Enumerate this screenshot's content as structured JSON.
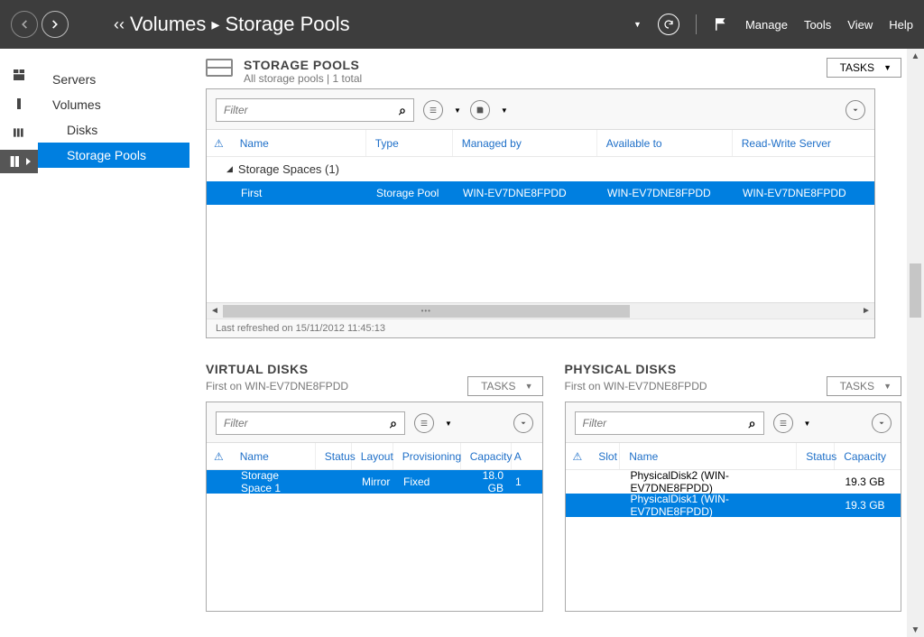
{
  "topbar": {
    "breadcrumb_preArrows": "‹‹",
    "breadcrumb_a": "Volumes",
    "breadcrumb_sep": "▸",
    "breadcrumb_b": "Storage Pools",
    "manage": "Manage",
    "tools": "Tools",
    "view": "View",
    "help": "Help"
  },
  "sidebar": {
    "servers": "Servers",
    "volumes": "Volumes",
    "disks": "Disks",
    "pools": "Storage Pools"
  },
  "pools": {
    "title": "STORAGE POOLS",
    "sub": "All storage pools | 1 total",
    "tasks": "TASKS",
    "filter_ph": "Filter",
    "col_name": "Name",
    "col_type": "Type",
    "col_managed": "Managed by",
    "col_avail": "Available to",
    "col_rw": "Read-Write Server",
    "group": "Storage Spaces (1)",
    "row_name": "First",
    "row_type": "Storage Pool",
    "row_managed": "WIN-EV7DNE8FPDD",
    "row_avail": "WIN-EV7DNE8FPDD",
    "row_rw": "WIN-EV7DNE8FPDD",
    "refreshed": "Last refreshed on 15/11/2012 11:45:13"
  },
  "vdisks": {
    "title": "VIRTUAL DISKS",
    "sub": "First on WIN-EV7DNE8FPDD",
    "tasks": "TASKS",
    "filter_ph": "Filter",
    "col_name": "Name",
    "col_status": "Status",
    "col_layout": "Layout",
    "col_prov": "Provisioning",
    "col_cap": "Capacity",
    "col_a": "A",
    "row_name": "Storage Space 1",
    "row_layout": "Mirror",
    "row_prov": "Fixed",
    "row_cap": "18.0 GB",
    "row_a": "1"
  },
  "pdisks": {
    "title": "PHYSICAL DISKS",
    "sub": "First on WIN-EV7DNE8FPDD",
    "tasks": "TASKS",
    "filter_ph": "Filter",
    "col_slot": "Slot",
    "col_name": "Name",
    "col_status": "Status",
    "col_cap": "Capacity",
    "row1_name": "PhysicalDisk2 (WIN-EV7DNE8FPDD)",
    "row1_cap": "19.3 GB",
    "row2_name": "PhysicalDisk1 (WIN-EV7DNE8FPDD)",
    "row2_cap": "19.3 GB"
  }
}
